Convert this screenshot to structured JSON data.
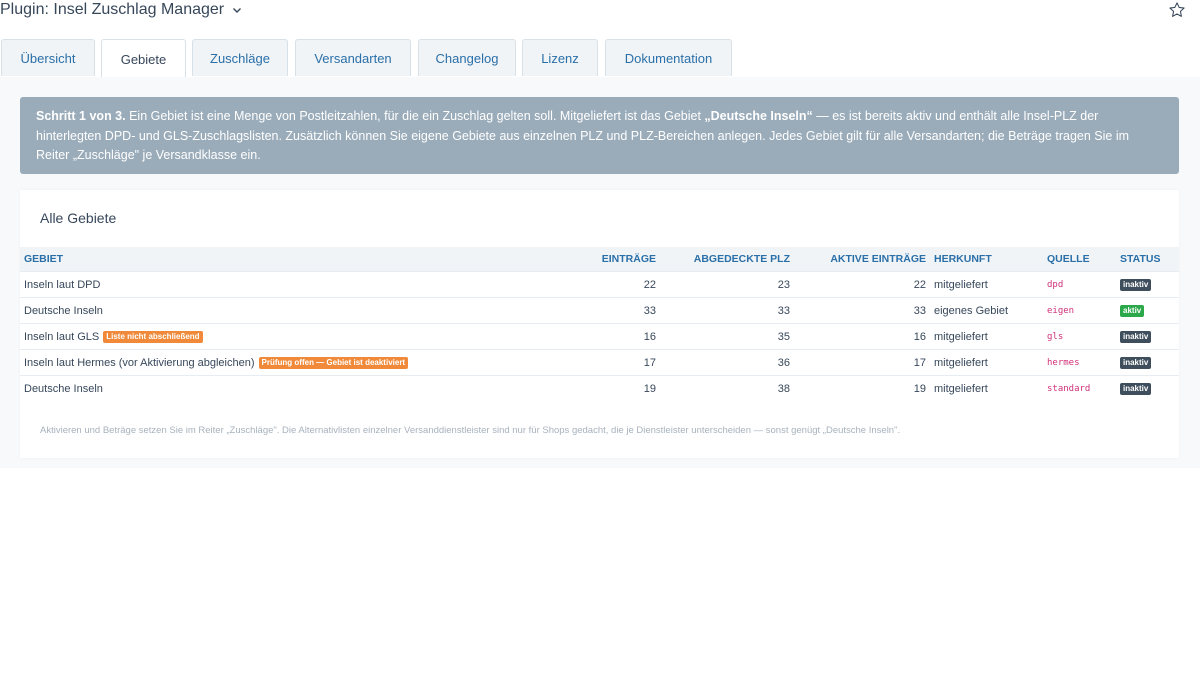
{
  "header": {
    "title": "Plugin: Insel Zuschlag Manager"
  },
  "tabs": [
    {
      "label": "Übersicht",
      "active": false
    },
    {
      "label": "Gebiete",
      "active": true
    },
    {
      "label": "Zuschläge",
      "active": false
    },
    {
      "label": "Versandarten",
      "active": false
    },
    {
      "label": "Changelog",
      "active": false
    },
    {
      "label": "Lizenz",
      "active": false
    },
    {
      "label": "Dokumentation",
      "active": false
    }
  ],
  "notice": {
    "step": "Schritt 1 von 3.",
    "text_a": " Ein Gebiet ist eine Menge von Postleitzahlen, für die ein Zuschlag gelten soll. Mitgeliefert ist das Gebiet ",
    "highlight": "„Deutsche Inseln“",
    "text_b": " — es ist bereits aktiv und enthält alle Insel-PLZ der hinterlegten DPD- und GLS-Zuschlagslisten. Zusätzlich können Sie eigene Gebiete aus einzelnen PLZ und PLZ-Bereichen anlegen. Jedes Gebiet gilt für alle Versandarten; die Beträge tragen Sie im Reiter „Zuschläge\" je Versandklasse ein."
  },
  "card": {
    "title": "Alle Gebiete",
    "columns": {
      "gebiet": "GEBIET",
      "eintraege": "EINTRÄGE",
      "plz": "ABGEDECKTE PLZ",
      "aktive": "AKTIVE EINTRÄGE",
      "herkunft": "HERKUNFT",
      "quelle": "QUELLE",
      "status": "STATUS"
    },
    "rows": [
      {
        "name": "Inseln laut DPD",
        "badge": "",
        "eintraege": "22",
        "plz": "23",
        "aktive": "22",
        "herkunft": "mitgeliefert",
        "quelle": "dpd",
        "status": "inaktiv"
      },
      {
        "name": "Deutsche Inseln",
        "badge": "",
        "eintraege": "33",
        "plz": "33",
        "aktive": "33",
        "herkunft": "eigenes Gebiet",
        "quelle": "eigen",
        "status": "aktiv"
      },
      {
        "name": "Inseln laut GLS",
        "badge": "Liste nicht abschließend",
        "eintraege": "16",
        "plz": "35",
        "aktive": "16",
        "herkunft": "mitgeliefert",
        "quelle": "gls",
        "status": "inaktiv"
      },
      {
        "name": "Inseln laut Hermes (vor Aktivierung abgleichen)",
        "badge": "Prüfung offen — Gebiet ist deaktiviert",
        "eintraege": "17",
        "plz": "36",
        "aktive": "17",
        "herkunft": "mitgeliefert",
        "quelle": "hermes",
        "status": "inaktiv"
      },
      {
        "name": "Deutsche Inseln",
        "badge": "",
        "eintraege": "19",
        "plz": "38",
        "aktive": "19",
        "herkunft": "mitgeliefert",
        "quelle": "standard",
        "status": "inaktiv"
      }
    ],
    "footnote": "Aktivieren und Beträge setzen Sie im Reiter „Zuschläge\". Die Alternativlisten einzelner Versanddienstleister sind nur für Shops gedacht, die je Dienstleister unterscheiden — sonst genügt „Deutsche Inseln\"."
  },
  "colors": {
    "accent": "#2a6fa8",
    "notice_bg": "#9aabb9",
    "warn": "#f08a3a",
    "active": "#2aa84a",
    "inactive": "#3f4e5c",
    "source": "#d0317a"
  },
  "icons": {
    "title_dropdown": "chevron-down-icon",
    "favorite": "star-outline-icon"
  }
}
